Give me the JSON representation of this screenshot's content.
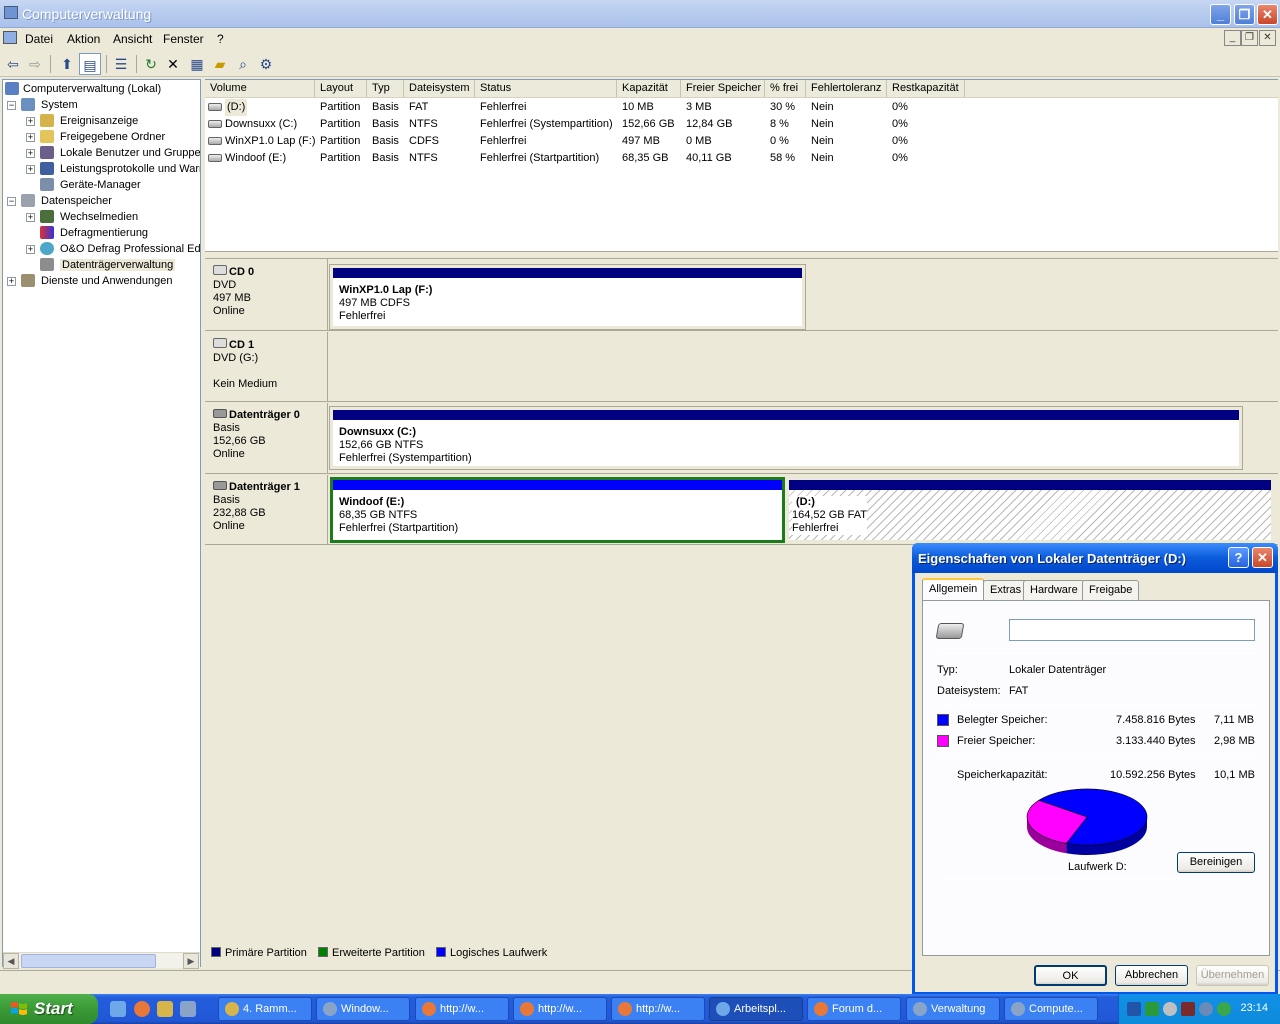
{
  "window": {
    "title": "Computerverwaltung"
  },
  "menu": [
    "Datei",
    "Aktion",
    "Ansicht",
    "Fenster",
    "?"
  ],
  "tree": {
    "root": "Computerverwaltung (Lokal)",
    "system": "System",
    "system_items": [
      "Ereignisanzeige",
      "Freigegebene Ordner",
      "Lokale Benutzer und Gruppen",
      "Leistungsprotokolle und Warnungen",
      "Geräte-Manager"
    ],
    "storage": "Datenspeicher",
    "storage_items": [
      "Wechselmedien",
      "Defragmentierung",
      "O&O Defrag Professional Edition",
      "Datenträgerverwaltung"
    ],
    "services": "Dienste und Anwendungen"
  },
  "volumes": {
    "columns": [
      "Volume",
      "Layout",
      "Typ",
      "Dateisystem",
      "Status",
      "Kapazität",
      "Freier Speicher",
      "% frei",
      "Fehlertoleranz",
      "Restkapazität"
    ],
    "rows": [
      [
        "(D:)",
        "Partition",
        "Basis",
        "FAT",
        "Fehlerfrei",
        "10 MB",
        "3 MB",
        "30 %",
        "Nein",
        "0%"
      ],
      [
        "Downsuxx (C:)",
        "Partition",
        "Basis",
        "NTFS",
        "Fehlerfrei (Systempartition)",
        "152,66 GB",
        "12,84 GB",
        "8 %",
        "Nein",
        "0%"
      ],
      [
        "WinXP1.0 Lap (F:)",
        "Partition",
        "Basis",
        "CDFS",
        "Fehlerfrei",
        "497 MB",
        "0 MB",
        "0 %",
        "Nein",
        "0%"
      ],
      [
        "Windoof (E:)",
        "Partition",
        "Basis",
        "NTFS",
        "Fehlerfrei (Startpartition)",
        "68,35 GB",
        "40,11 GB",
        "58 %",
        "Nein",
        "0%"
      ]
    ]
  },
  "disks": {
    "cd0": {
      "name": "CD 0",
      "l1": "DVD",
      "l2": "497 MB",
      "l3": "Online",
      "p_name": "WinXP1.0 Lap  (F:)",
      "p_size": "497 MB CDFS",
      "p_status": "Fehlerfrei"
    },
    "cd1": {
      "name": "CD 1",
      "l1": "DVD (G:)",
      "l3": "Kein Medium"
    },
    "d0": {
      "name": "Datenträger 0",
      "l1": "Basis",
      "l2": "152,66 GB",
      "l3": "Online",
      "p_name": "Downsuxx  (C:)",
      "p_size": "152,66 GB NTFS",
      "p_status": "Fehlerfrei (Systempartition)"
    },
    "d1": {
      "name": "Datenträger 1",
      "l1": "Basis",
      "l2": "232,88 GB",
      "l3": "Online",
      "p1_name": "Windoof  (E:)",
      "p1_size": "68,35 GB NTFS",
      "p1_status": "Fehlerfrei (Startpartition)",
      "p2_name": "(D:)",
      "p2_size": "164,52 GB FAT",
      "p2_status": "Fehlerfrei"
    }
  },
  "legend": [
    "Primäre Partition",
    "Erweiterte Partition",
    "Logisches Laufwerk"
  ],
  "colors": {
    "primary": "#000080",
    "extended": "#008000",
    "logical": "#0000ff",
    "used": "#0000ff",
    "free": "#ff00ff"
  },
  "dialog": {
    "title": "Eigenschaften von Lokaler Datenträger (D:)",
    "tabs": [
      "Allgemein",
      "Extras",
      "Hardware",
      "Freigabe"
    ],
    "name_value": "",
    "typ_label": "Typ:",
    "typ_value": "Lokaler Datenträger",
    "fs_label": "Dateisystem:",
    "fs_value": "FAT",
    "used_label": "Belegter Speicher:",
    "used_bytes": "7.458.816 Bytes",
    "used_mb": "7,11 MB",
    "free_label": "Freier Speicher:",
    "free_bytes": "3.133.440 Bytes",
    "free_mb": "2,98 MB",
    "cap_label": "Speicherkapazität:",
    "cap_bytes": "10.592.256 Bytes",
    "cap_mb": "10,1 MB",
    "used_fraction": 0.704,
    "drive_label": "Laufwerk D:",
    "cleanup_btn": "Bereinigen",
    "ok": "OK",
    "cancel": "Abbrechen",
    "apply": "Übernehmen"
  },
  "taskbar": {
    "start": "Start",
    "tasks": [
      "4. Ramm...",
      "Window...",
      "http://w...",
      "http://w...",
      "http://w...",
      "Arbeitspl...",
      "Forum d...",
      "Verwaltung",
      "Compute..."
    ],
    "clock": "23:14"
  }
}
